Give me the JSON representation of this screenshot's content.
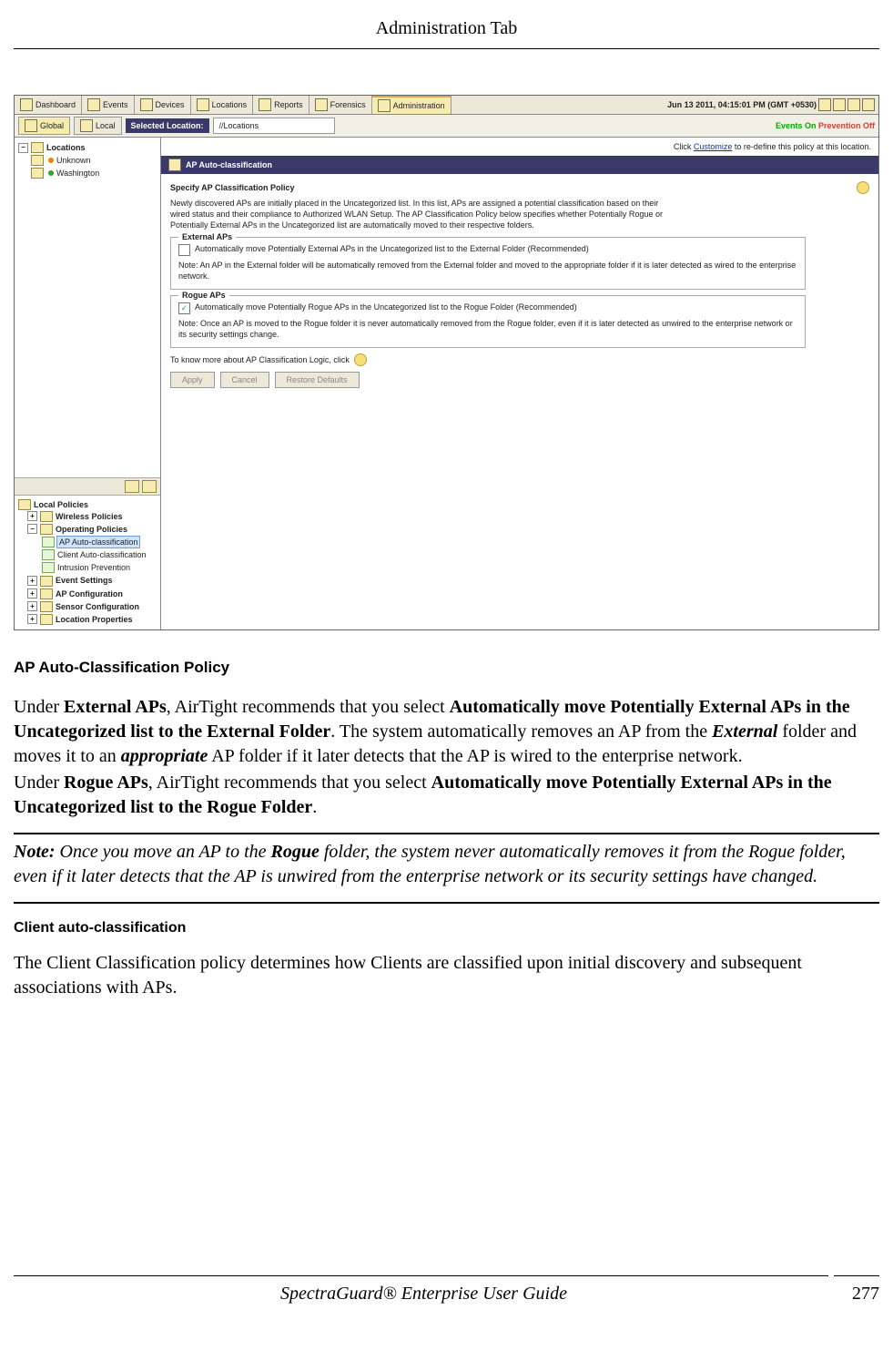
{
  "page": {
    "header_title": "Administration Tab",
    "footer_title": "SpectraGuard® Enterprise User Guide",
    "page_number": "277"
  },
  "app": {
    "tabs": [
      "Dashboard",
      "Events",
      "Devices",
      "Locations",
      "Reports",
      "Forensics",
      "Administration"
    ],
    "clock": "Jun 13 2011, 04:15:01 PM (GMT +0530)",
    "sub": {
      "global": "Global",
      "local": "Local",
      "selected_label": "Selected Location:",
      "selected_path": "//Locations",
      "events_on": "Events On",
      "prevention_off": "Prevention Off"
    },
    "tree": {
      "root": "Locations",
      "c1": "Unknown",
      "c2": "Washington"
    },
    "policies": {
      "header": "Local Policies",
      "n1": "Wireless Policies",
      "n2": "Operating Policies",
      "n2a": "AP Auto-classification",
      "n2b": "Client Auto-classification",
      "n2c": "Intrusion Prevention",
      "n3": "Event Settings",
      "n4": "AP Configuration",
      "n5": "Sensor Configuration",
      "n6": "Location Properties"
    },
    "customize": {
      "prefix": "Click ",
      "link": "Customize",
      "suffix": " to re-define this policy at this location."
    },
    "panel": {
      "title": "AP Auto-classification",
      "heading": "Specify AP Classification Policy",
      "desc": "Newly discovered APs are initially placed in the Uncategorized list. In this list, APs are assigned a potential classification based on their wired status and their compliance to Authorized WLAN Setup. The AP Classification Policy below specifies whether Potentially Rogue or Potentially External APs in the Uncategorized list are automatically moved to their respective folders.",
      "ext_legend": "External APs",
      "ext_chk": "Automatically move Potentially External APs in the Uncategorized list to the External Folder (Recommended)",
      "ext_note": "Note: An AP in the External folder will be automatically removed from the External folder and moved to the appropriate folder if it is later detected as wired to the enterprise network.",
      "rogue_legend": "Rogue APs",
      "rogue_chk": "Automatically move Potentially Rogue APs in the Uncategorized list to the Rogue Folder (Recommended)",
      "rogue_note": "Note: Once an AP is moved to the Rogue folder it is never automatically removed from the Rogue folder, even if it is later detected as unwired to the enterprise network or its security settings change.",
      "know_more": "To know more about AP Classification Logic, click",
      "btn_apply": "Apply",
      "btn_cancel": "Cancel",
      "btn_restore": "Restore Defaults"
    }
  },
  "doc": {
    "h1": "AP Auto-Classification Policy",
    "p1a": "Under ",
    "p1b": "External APs",
    "p1c": ", AirTight recommends that you select ",
    "p1d": "Automatically move Potentially External APs in the Uncategorized list to the External Folder",
    "p1e": ". The system automatically removes an AP from the ",
    "p1f": "External",
    "p1g": " folder and moves it to an ",
    "p1h": "appropriate",
    "p1i": " AP folder if it later detects that the AP is wired to the enterprise network.",
    "p2a": "Under ",
    "p2b": "Rogue APs",
    "p2c": ", AirTight recommends that you select ",
    "p2d": "Automatically move Potentially External APs in the Uncategorized list to the Rogue Folder",
    "p2e": ".",
    "note_a": "Note:",
    "note_b": " Once you move an AP to the ",
    "note_c": "Rogue",
    "note_d": " folder, the system never automatically removes it from the Rogue folder, even if it later detects that the AP is unwired from the enterprise network or its security settings have changed.",
    "h2": "Client auto-classification",
    "p3": "The Client Classification policy determines how Clients are classified upon initial discovery and subsequent associations with APs."
  }
}
